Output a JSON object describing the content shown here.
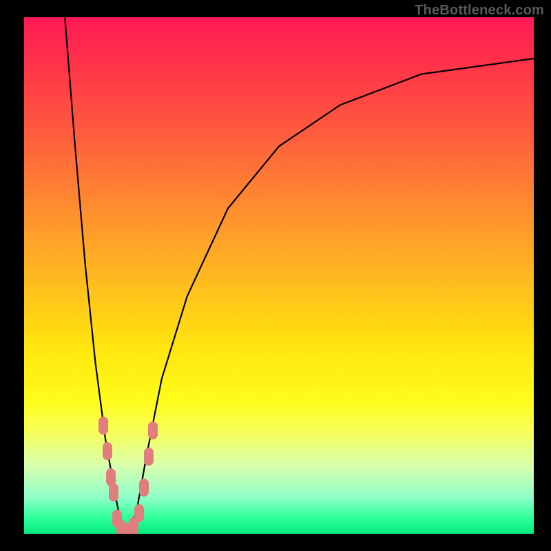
{
  "watermark": "TheBottleneck.com",
  "colors": {
    "frame": "#000000",
    "curve": "#000000",
    "blob": "#e17d7d"
  },
  "chart_data": {
    "type": "line",
    "title": "",
    "xlabel": "",
    "ylabel": "",
    "xlim": [
      0,
      100
    ],
    "ylim": [
      0,
      100
    ],
    "note": "Axes unlabeled in image; values are normalized 0–100 estimates read from pixel positions. Y-axis inverted visually (0% at bottom = green/good, 100% at top = red/bad).",
    "series": [
      {
        "name": "left-branch",
        "x": [
          8,
          10,
          12,
          14,
          16,
          18,
          19,
          20
        ],
        "y": [
          100,
          75,
          52,
          33,
          18,
          7,
          2,
          0
        ]
      },
      {
        "name": "right-branch",
        "x": [
          20,
          22,
          24,
          27,
          32,
          40,
          50,
          62,
          78,
          100
        ],
        "y": [
          0,
          4,
          15,
          30,
          46,
          63,
          75,
          83,
          89,
          92
        ]
      }
    ],
    "markers": {
      "name": "highlighted-points",
      "note": "Pink lozenge markers clustered near the curve minimum",
      "points": [
        {
          "x": 15.5,
          "y": 21
        },
        {
          "x": 16.3,
          "y": 16
        },
        {
          "x": 17.0,
          "y": 11
        },
        {
          "x": 17.5,
          "y": 8
        },
        {
          "x": 18.2,
          "y": 3
        },
        {
          "x": 19.0,
          "y": 1
        },
        {
          "x": 20.0,
          "y": 0
        },
        {
          "x": 20.8,
          "y": 0.5
        },
        {
          "x": 21.5,
          "y": 1.5
        },
        {
          "x": 22.5,
          "y": 4
        },
        {
          "x": 23.5,
          "y": 9
        },
        {
          "x": 24.5,
          "y": 15
        },
        {
          "x": 25.3,
          "y": 20
        }
      ]
    }
  }
}
